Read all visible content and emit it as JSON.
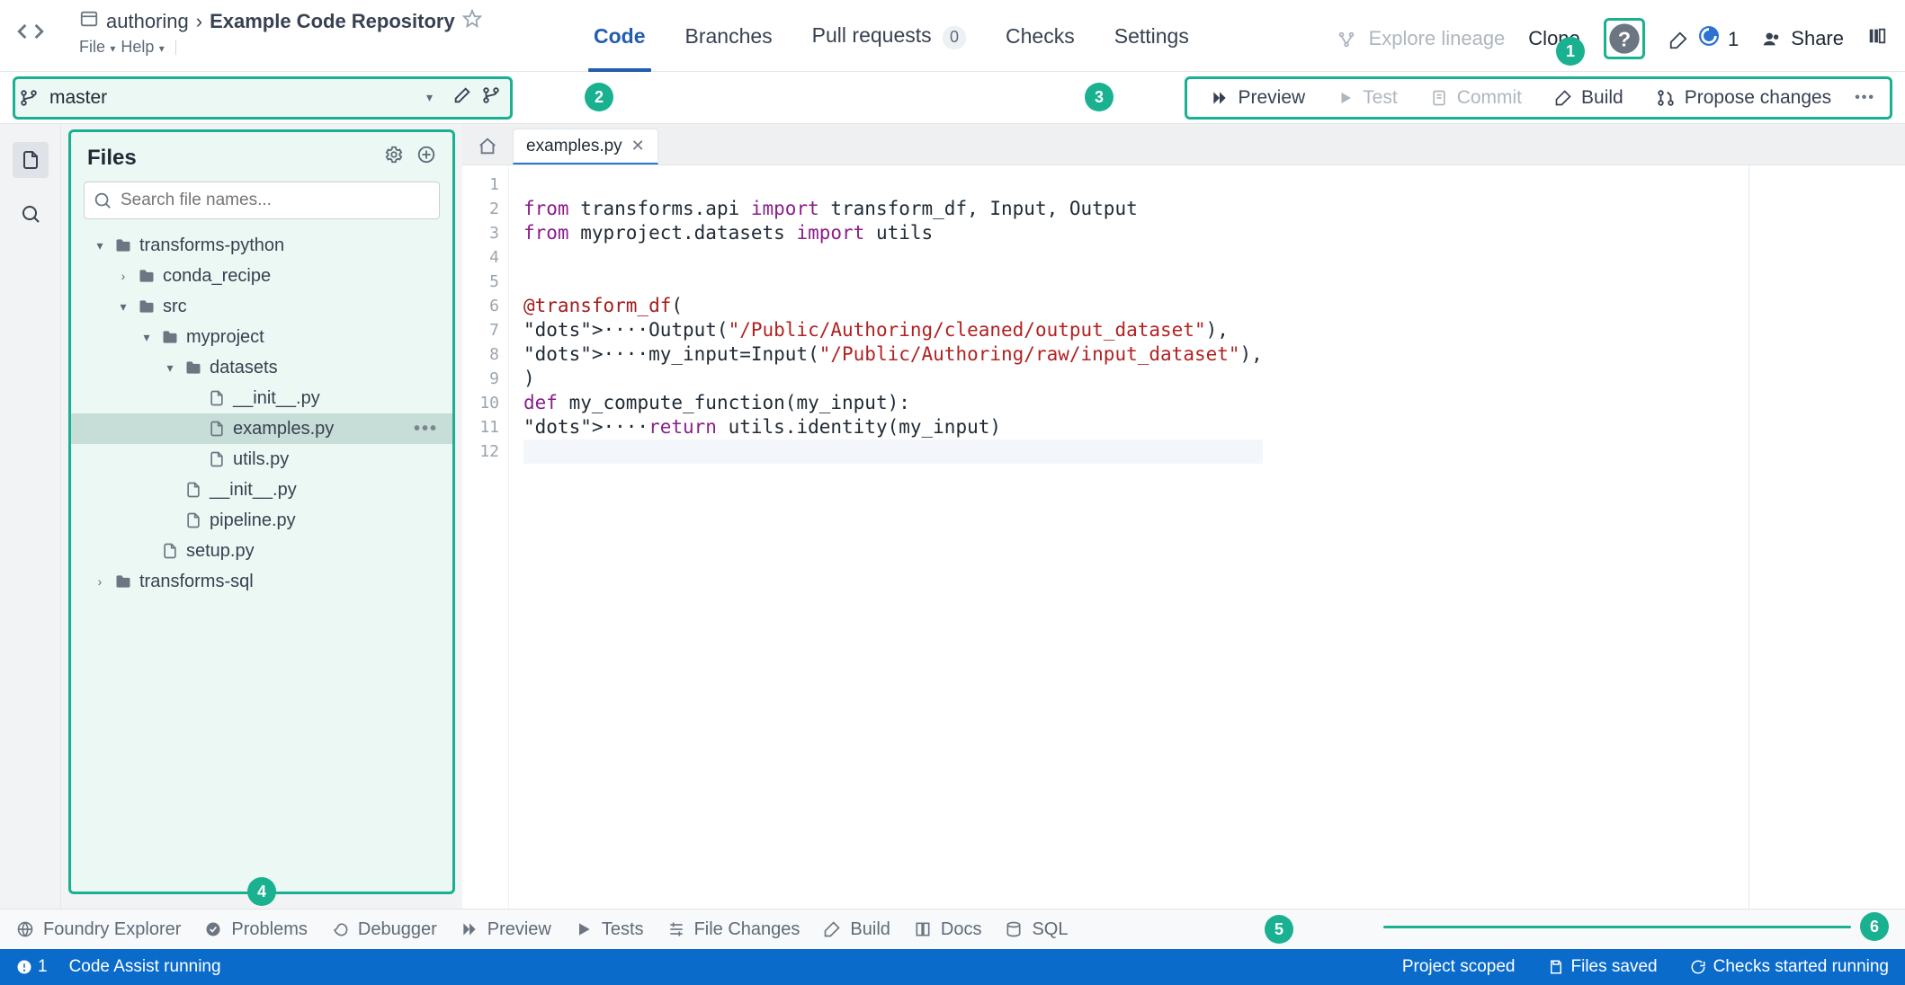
{
  "breadcrumb": {
    "root": "authoring",
    "sep": "›",
    "repo": "Example Code Repository"
  },
  "menus": {
    "file": "File",
    "help": "Help"
  },
  "tabs": {
    "code": "Code",
    "branches": "Branches",
    "pull_requests": "Pull requests",
    "pr_count": "0",
    "checks": "Checks",
    "settings": "Settings"
  },
  "header_right": {
    "explore_lineage": "Explore lineage",
    "clone": "Clone",
    "status_count": "1",
    "share": "Share"
  },
  "callouts": {
    "c1": "1",
    "c2": "2",
    "c3": "3",
    "c4": "4",
    "c5": "5",
    "c6": "6"
  },
  "branch": {
    "name": "master"
  },
  "actions": {
    "preview": "Preview",
    "test": "Test",
    "commit": "Commit",
    "build": "Build",
    "propose": "Propose changes"
  },
  "files": {
    "title": "Files",
    "search_placeholder": "Search file names...",
    "tree": [
      {
        "name": "transforms-python",
        "type": "folder",
        "depth": 0,
        "expanded": true
      },
      {
        "name": "conda_recipe",
        "type": "folder",
        "depth": 1,
        "expanded": false
      },
      {
        "name": "src",
        "type": "folder",
        "depth": 1,
        "expanded": true
      },
      {
        "name": "myproject",
        "type": "folder",
        "depth": 2,
        "expanded": true
      },
      {
        "name": "datasets",
        "type": "folder",
        "depth": 3,
        "expanded": true
      },
      {
        "name": "__init__.py",
        "type": "file",
        "depth": 4
      },
      {
        "name": "examples.py",
        "type": "file",
        "depth": 4,
        "selected": true
      },
      {
        "name": "utils.py",
        "type": "file",
        "depth": 4
      },
      {
        "name": "__init__.py",
        "type": "file",
        "depth": 3
      },
      {
        "name": "pipeline.py",
        "type": "file",
        "depth": 3
      },
      {
        "name": "setup.py",
        "type": "file",
        "depth": 2
      },
      {
        "name": "transforms-sql",
        "type": "folder",
        "depth": 0,
        "expanded": false
      }
    ]
  },
  "editor": {
    "tab_title": "examples.py",
    "line_count": 12,
    "lines": [
      "",
      "from transforms.api import transform_df, Input, Output",
      "from myproject.datasets import utils",
      "",
      "",
      "@transform_df(",
      "    Output(\"/Public/Authoring/cleaned/output_dataset\"),",
      "    my_input=Input(\"/Public/Authoring/raw/input_dataset\"),",
      ")",
      "def my_compute_function(my_input):",
      "    return utils.identity(my_input)",
      ""
    ]
  },
  "bottom": {
    "foundry_explorer": "Foundry Explorer",
    "problems": "Problems",
    "debugger": "Debugger",
    "preview": "Preview",
    "tests": "Tests",
    "file_changes": "File Changes",
    "build": "Build",
    "docs": "Docs",
    "sql": "SQL"
  },
  "status": {
    "count": "1",
    "code_assist": "Code Assist running",
    "scope": "Project scoped",
    "saved": "Files saved",
    "checks": "Checks started running"
  }
}
